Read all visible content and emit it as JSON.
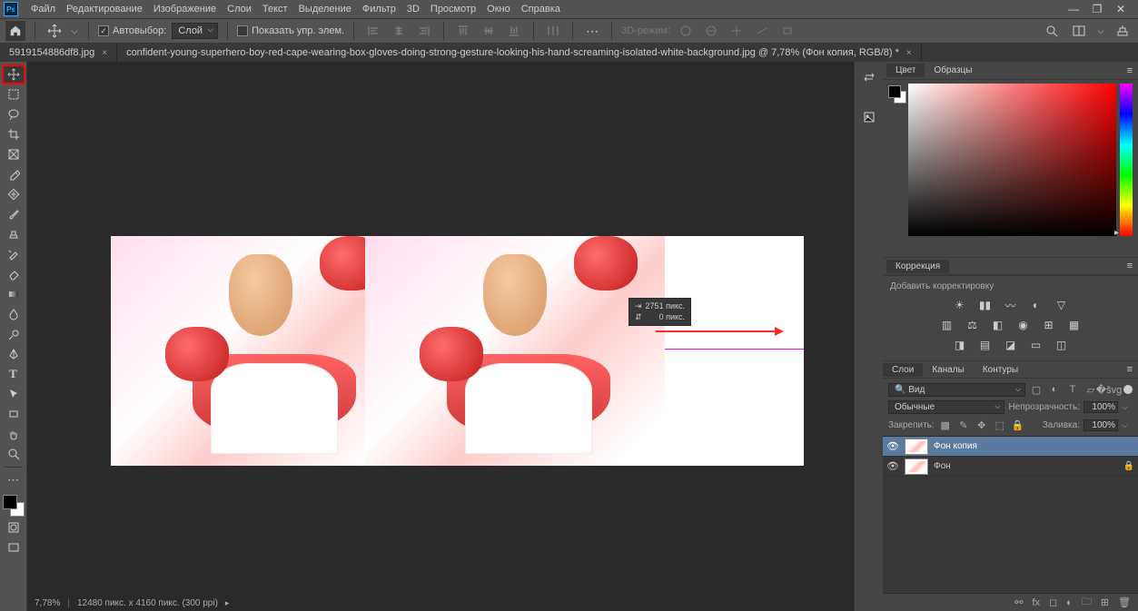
{
  "app": {
    "logo": "Ps"
  },
  "menu": {
    "items": [
      "Файл",
      "Редактирование",
      "Изображение",
      "Слои",
      "Текст",
      "Выделение",
      "Фильтр",
      "3D",
      "Просмотр",
      "Окно",
      "Справка"
    ]
  },
  "options": {
    "autoselect_label": "Автовыбор:",
    "target_label": "Слой",
    "show_transform_label": "Показать упр. элем.",
    "three_d_label": "3D-режим:"
  },
  "tabs": [
    {
      "label": "5919154886df8.jpg",
      "active": false
    },
    {
      "label": "confident-young-superhero-boy-red-cape-wearing-box-gloves-doing-strong-gesture-looking-his-hand-screaming-isolated-white-background.jpg @ 7,78% (Фон копия, RGB/8) *",
      "active": true
    }
  ],
  "status": {
    "zoom": "7,78%",
    "docinfo": "12480 пикс. x 4160 пикс. (300 ppi)"
  },
  "transform_tip": {
    "dx_label": "⇥",
    "dx_value": "2751 пикс.",
    "dy_label": "⇵",
    "dy_value": "0 пикс."
  },
  "panels": {
    "color": {
      "tab1": "Цвет",
      "tab2": "Образцы"
    },
    "adjustments": {
      "title": "Коррекция",
      "hint": "Добавить корректировку"
    },
    "layers": {
      "tab1": "Слои",
      "tab2": "Каналы",
      "tab3": "Контуры",
      "kind_prefix": "🔍",
      "kind_label": "Вид",
      "blend_label": "Обычные",
      "opacity_label": "Непрозрачность:",
      "opacity_value": "100%",
      "lock_label": "Закрепить:",
      "fill_label": "Заливка:",
      "fill_value": "100%",
      "items": [
        {
          "name": "Фон копия",
          "locked": false
        },
        {
          "name": "Фон",
          "locked": true
        }
      ]
    }
  }
}
